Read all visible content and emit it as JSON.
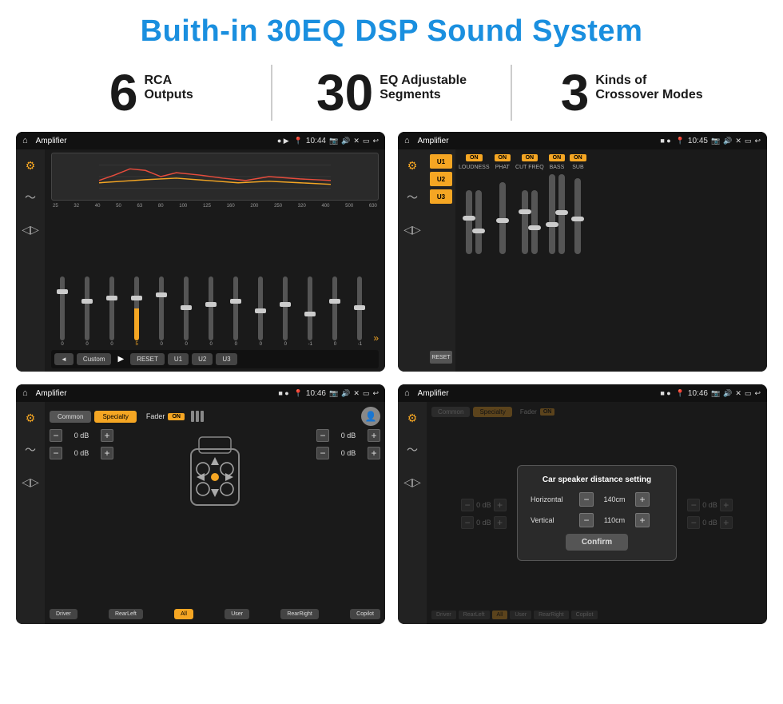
{
  "page": {
    "title": "Buith-in 30EQ DSP Sound System"
  },
  "stats": [
    {
      "number": "6",
      "line1": "RCA",
      "line2": "Outputs"
    },
    {
      "number": "30",
      "line1": "EQ Adjustable",
      "line2": "Segments"
    },
    {
      "number": "3",
      "line1": "Kinds of",
      "line2": "Crossover Modes"
    }
  ],
  "screens": [
    {
      "id": "screen1",
      "status_title": "Amplifier",
      "time": "10:44",
      "type": "eq"
    },
    {
      "id": "screen2",
      "status_title": "Amplifier",
      "time": "10:45",
      "type": "amp"
    },
    {
      "id": "screen3",
      "status_title": "Amplifier",
      "time": "10:46",
      "type": "fader"
    },
    {
      "id": "screen4",
      "status_title": "Amplifier",
      "time": "10:46",
      "type": "dialog"
    }
  ],
  "eq": {
    "freq_labels": [
      "25",
      "32",
      "40",
      "50",
      "63",
      "80",
      "100",
      "125",
      "160",
      "200",
      "250",
      "320",
      "400",
      "500",
      "630"
    ],
    "values": [
      "0",
      "0",
      "0",
      "5",
      "0",
      "0",
      "0",
      "0",
      "0",
      "0",
      "-1",
      "0",
      "-1"
    ],
    "presets": [
      "Custom",
      "RESET",
      "U1",
      "U2",
      "U3"
    ],
    "play_label": "▶"
  },
  "amp": {
    "presets": [
      "U1",
      "U2",
      "U3"
    ],
    "reset": "RESET",
    "controls": [
      "LOUDNESS",
      "PHAT",
      "CUT FREQ",
      "BASS",
      "SUB"
    ],
    "on_label": "ON"
  },
  "fader": {
    "modes": [
      "Common",
      "Specialty"
    ],
    "fader_label": "Fader",
    "on_label": "ON",
    "buttons": [
      "Driver",
      "RearLeft",
      "All",
      "User",
      "RearRight",
      "Copilot"
    ],
    "db_values": [
      "0 dB",
      "0 dB",
      "0 dB",
      "0 dB"
    ]
  },
  "dialog": {
    "title": "Car speaker distance setting",
    "horizontal_label": "Horizontal",
    "horizontal_value": "140cm",
    "vertical_label": "Vertical",
    "vertical_value": "110cm",
    "confirm_label": "Confirm",
    "modes": [
      "Common",
      "Specialty"
    ],
    "on_label": "ON"
  }
}
